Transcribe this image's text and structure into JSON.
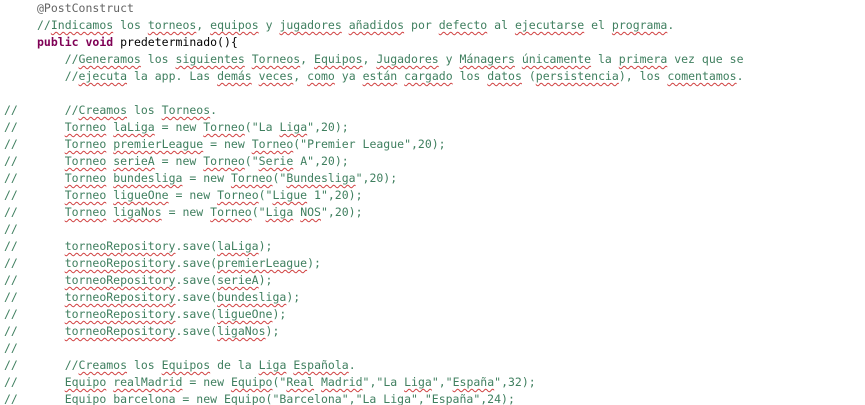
{
  "editor": {
    "lines": [
      {
        "gutter": "",
        "segments": [
          {
            "text": "@PostConstruct",
            "kind": "annotation"
          }
        ]
      },
      {
        "gutter": "",
        "segments": [
          {
            "text": "//Indicamos los torneos, equipos y jugadores añadidos por defecto al ejecutarse el programa.",
            "kind": "comment"
          }
        ]
      },
      {
        "gutter": "",
        "segments": [
          {
            "text": "public",
            "kind": "keyword"
          },
          {
            "text": " ",
            "kind": "plain"
          },
          {
            "text": "void",
            "kind": "keyword"
          },
          {
            "text": " predeterminado(){",
            "kind": "plain"
          }
        ]
      },
      {
        "gutter": "",
        "segments": [
          {
            "text": "    //Generamos los siguientes Torneos, Equipos, Jugadores y Mánagers únicamente la primera vez que se",
            "kind": "comment"
          }
        ]
      },
      {
        "gutter": "",
        "segments": [
          {
            "text": "    //ejecuta la app. Las demás veces, como ya están cargado los datos (persistencia), los comentamos.",
            "kind": "comment"
          }
        ]
      },
      {
        "gutter": "",
        "segments": []
      },
      {
        "gutter": "//",
        "segments": [
          {
            "text": "    //Creamos los Torneos.",
            "kind": "comment"
          }
        ]
      },
      {
        "gutter": "//",
        "segments": [
          {
            "text": "    Torneo laLiga = new Torneo(\"La Liga\",20);",
            "kind": "comment"
          }
        ]
      },
      {
        "gutter": "//",
        "segments": [
          {
            "text": "    Torneo premierLeague = new Torneo(\"Premier League\",20);",
            "kind": "comment"
          }
        ]
      },
      {
        "gutter": "//",
        "segments": [
          {
            "text": "    Torneo serieA = new Torneo(\"Serie A\",20);",
            "kind": "comment"
          }
        ]
      },
      {
        "gutter": "//",
        "segments": [
          {
            "text": "    Torneo bundesliga = new Torneo(\"Bundesliga\",20);",
            "kind": "comment"
          }
        ]
      },
      {
        "gutter": "//",
        "segments": [
          {
            "text": "    Torneo ligueOne = new Torneo(\"Ligue 1\",20);",
            "kind": "comment"
          }
        ]
      },
      {
        "gutter": "//",
        "segments": [
          {
            "text": "    Torneo ligaNos = new Torneo(\"Liga NOS\",20);",
            "kind": "comment"
          }
        ]
      },
      {
        "gutter": "//",
        "segments": []
      },
      {
        "gutter": "//",
        "segments": [
          {
            "text": "    torneoRepository.save(laLiga);",
            "kind": "comment"
          }
        ]
      },
      {
        "gutter": "//",
        "segments": [
          {
            "text": "    torneoRepository.save(premierLeague);",
            "kind": "comment"
          }
        ]
      },
      {
        "gutter": "//",
        "segments": [
          {
            "text": "    torneoRepository.save(serieA);",
            "kind": "comment"
          }
        ]
      },
      {
        "gutter": "//",
        "segments": [
          {
            "text": "    torneoRepository.save(bundesliga);",
            "kind": "comment"
          }
        ]
      },
      {
        "gutter": "//",
        "segments": [
          {
            "text": "    torneoRepository.save(ligueOne);",
            "kind": "comment"
          }
        ]
      },
      {
        "gutter": "//",
        "segments": [
          {
            "text": "    torneoRepository.save(ligaNos);",
            "kind": "comment"
          }
        ]
      },
      {
        "gutter": "//",
        "segments": []
      },
      {
        "gutter": "//",
        "segments": [
          {
            "text": "    //Creamos los Equipos de la Liga Española.",
            "kind": "comment"
          }
        ]
      },
      {
        "gutter": "//",
        "segments": [
          {
            "text": "    Equipo realMadrid = new Equipo(\"Real Madrid\",\"La Liga\",\"España\",32);",
            "kind": "comment"
          }
        ]
      },
      {
        "gutter": "//",
        "segments": [
          {
            "text": "    Equipo barcelona = new Equipo(\"Barcelona\",\"La Liga\",\"España\",24);",
            "kind": "comment"
          }
        ]
      }
    ],
    "spellcheck_words": [
      "Indicamos",
      "torneos",
      "equipos",
      "jugadores",
      "añadidos",
      "defecto",
      "ejecutarse",
      "programa",
      "Generamos",
      "siguientes",
      "Torneos",
      "Equipos",
      "Jugadores",
      "Mánagers",
      "únicamente",
      "primera",
      "ejecuta",
      "demás",
      "veces",
      "como",
      "están",
      "cargado",
      "datos",
      "persistencia",
      "comentamos",
      "Creamos",
      "Torneo",
      "bundesliga",
      "Bundesliga",
      "ligueOne",
      "ligaNos",
      "NOS",
      "laLiga",
      "Liga",
      "premierLeague",
      "serieA",
      "Serie",
      "Ligue",
      "torneoRepository",
      "Equipo",
      "realMadrid",
      "Real",
      "Madrid",
      "España",
      "barcelona",
      "Barcelona",
      "Española",
      "predeterminado"
    ]
  },
  "colors": {
    "background": "#ffffff",
    "comment": "#3f7f5f",
    "keyword": "#7f0055",
    "annotation": "#646464",
    "spellcheck_underline": "#d04040"
  }
}
